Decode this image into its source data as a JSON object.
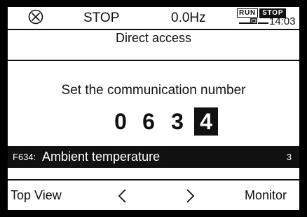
{
  "status": {
    "state": "STOP",
    "frequency": "0.0Hz",
    "run_label": "RUN",
    "stop_label": "STOP",
    "time": "14:03"
  },
  "screen": {
    "title": "Direct access",
    "prompt": "Set the communication number",
    "digits": [
      "0",
      "6",
      "3",
      "4"
    ],
    "selected_digit_index": 3
  },
  "info": {
    "code": "F634:",
    "label": "Ambient temperature",
    "value": "3"
  },
  "softkeys": {
    "left": "Top View",
    "right": "Monitor"
  },
  "icons": {
    "status": "circle-x-icon",
    "battery": "battery-icon",
    "prev": "chevron-left-icon",
    "next": "chevron-right-icon"
  }
}
